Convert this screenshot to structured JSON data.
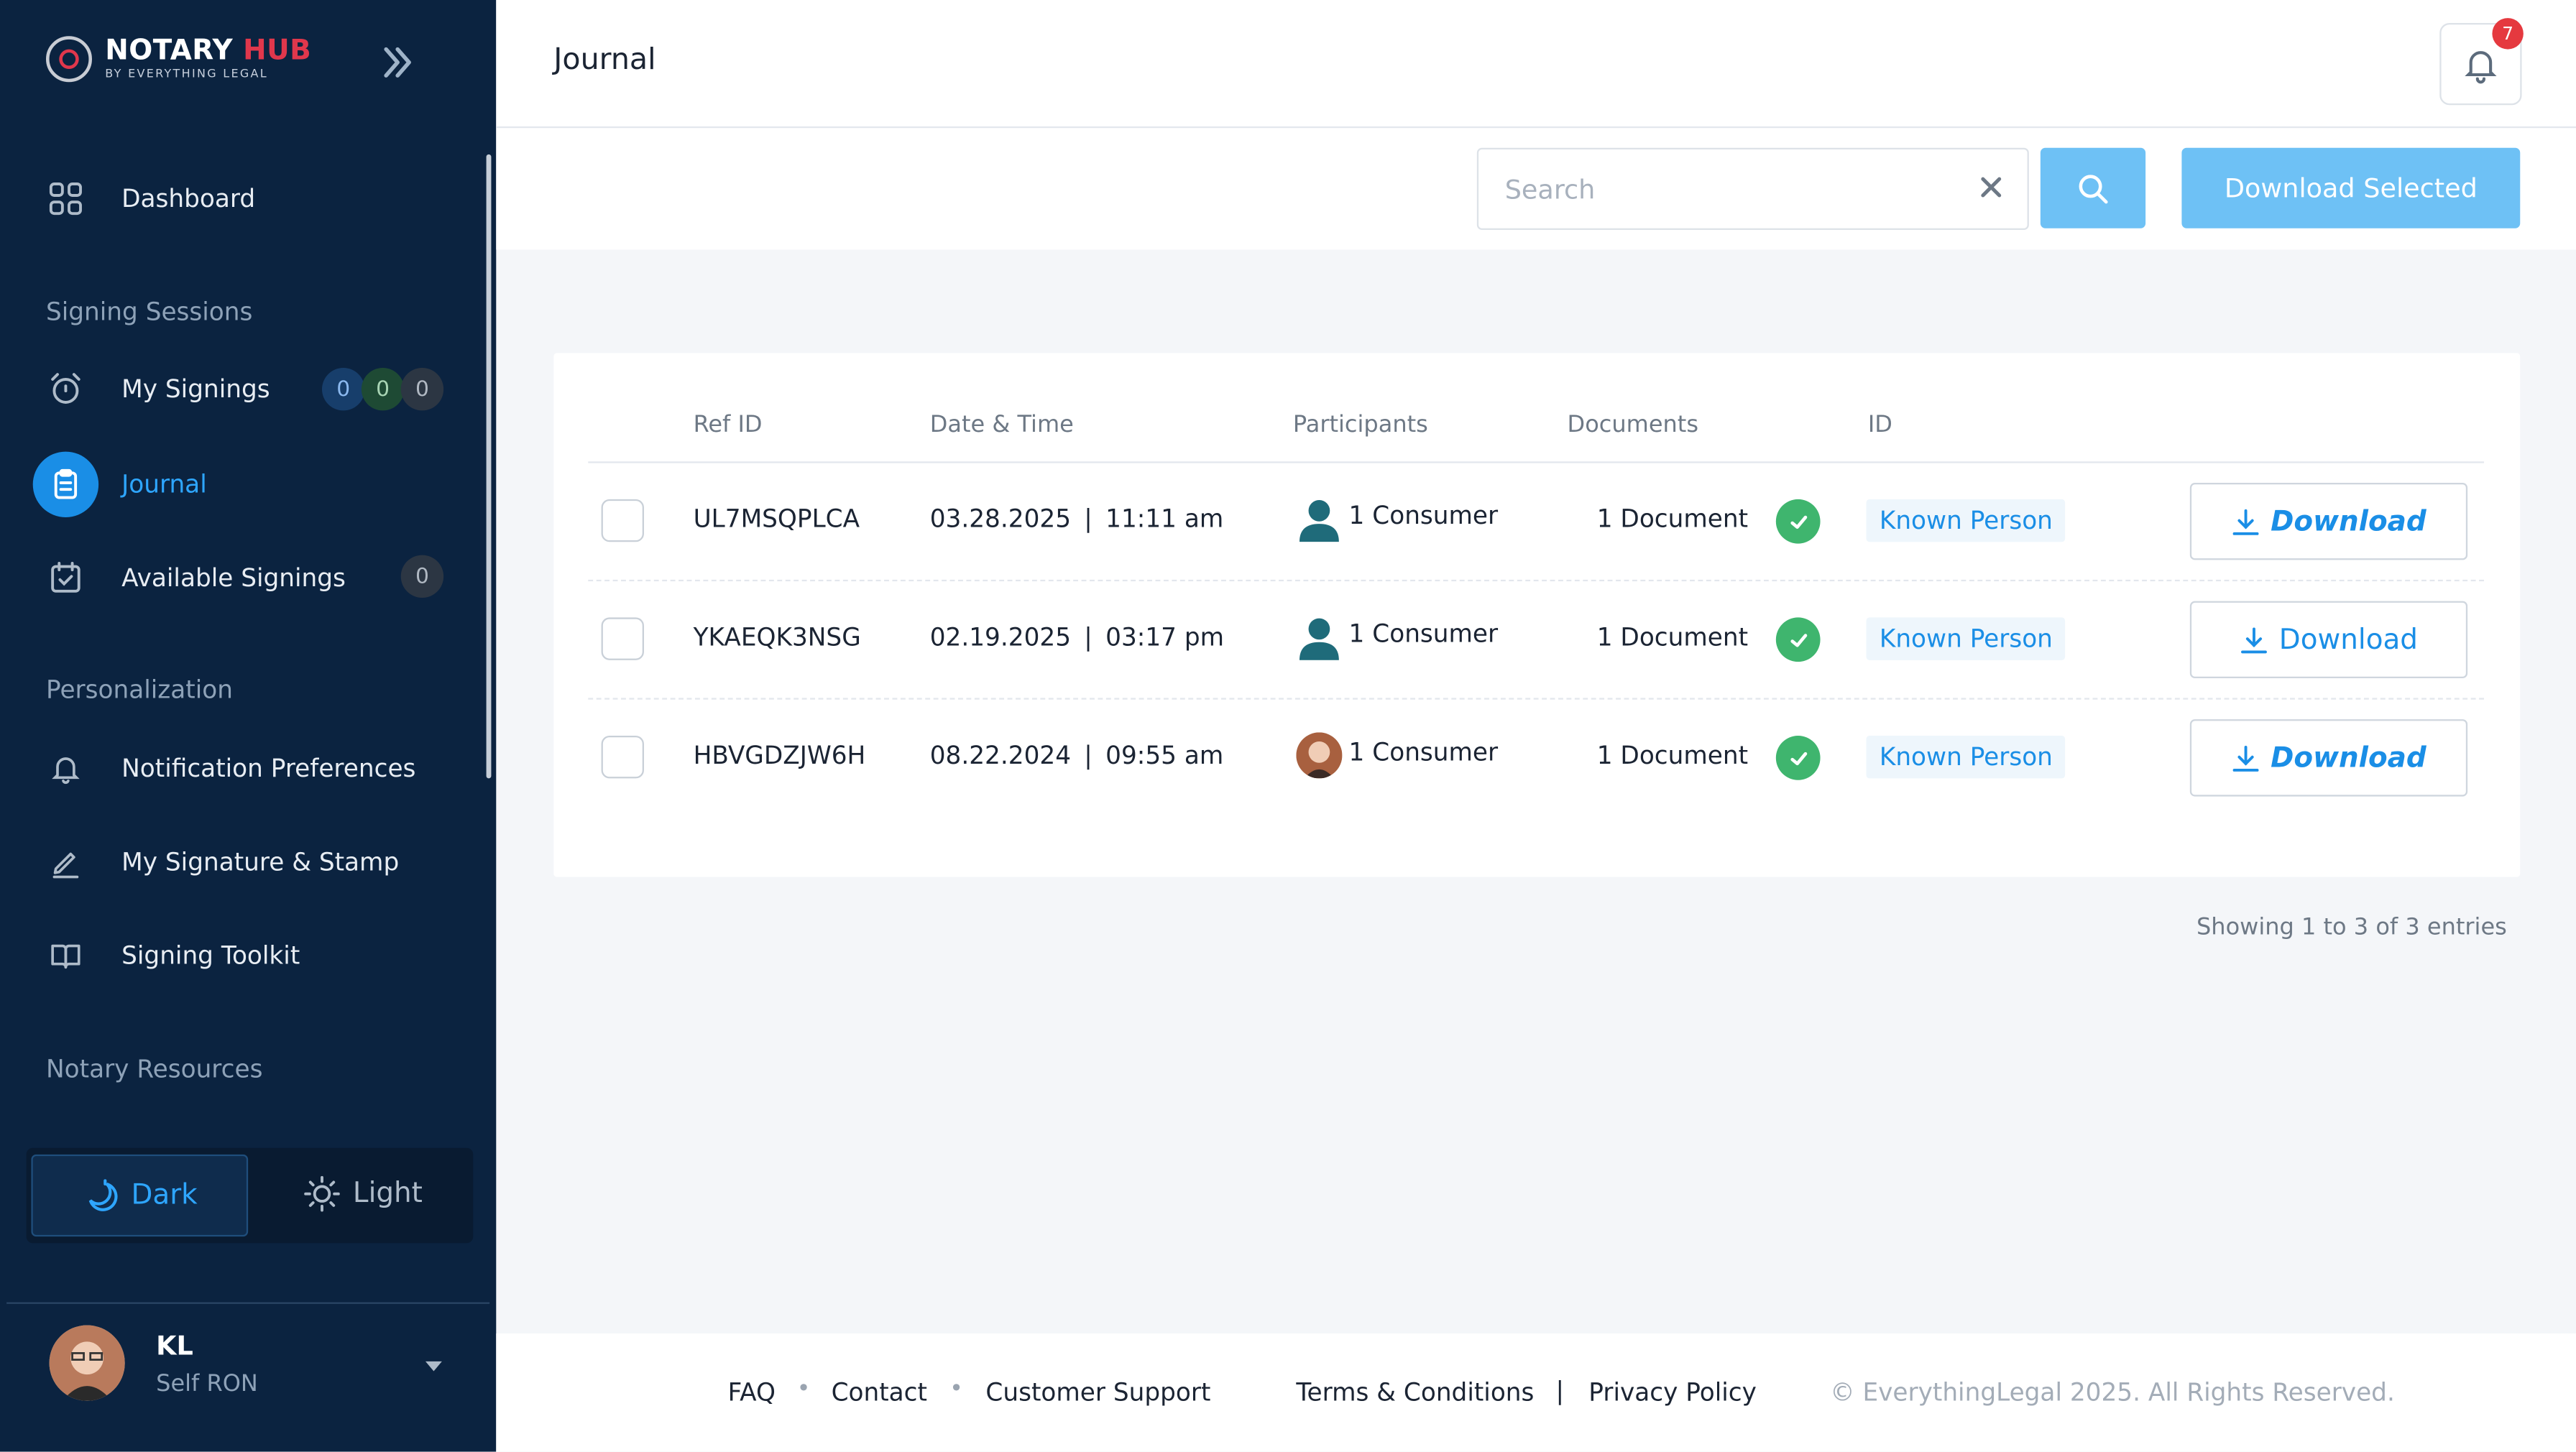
{
  "brand": {
    "name_a": "NOTARY",
    "name_b": "HUB",
    "tagline": "BY EVERYTHING LEGAL"
  },
  "sidebar": {
    "dashboard": "Dashboard",
    "signing_sessions": "Signing Sessions",
    "my_signings": "My Signings",
    "my_signings_counts": [
      "0",
      "0",
      "0"
    ],
    "journal": "Journal",
    "available_signings": "Available Signings",
    "available_count": "0",
    "personalization": "Personalization",
    "notification_prefs": "Notification Preferences",
    "signature_stamp": "My Signature & Stamp",
    "signing_toolkit": "Signing Toolkit",
    "notary_resources": "Notary Resources",
    "theme": {
      "dark": "Dark",
      "light": "Light",
      "selected": "Dark"
    },
    "user": {
      "initials": "KL",
      "role": "Self RON"
    }
  },
  "header": {
    "title": "Journal",
    "notification_count": "7"
  },
  "toolbar": {
    "search_placeholder": "Search",
    "search_value": "",
    "download_selected": "Download Selected"
  },
  "table": {
    "columns": [
      "Ref ID",
      "Date & Time",
      "Participants",
      "Documents",
      "ID"
    ],
    "rows": [
      {
        "ref": "UL7MSQPLCA",
        "date": "03.28.2025",
        "time": "11:11 am",
        "participants": "1 Consumer",
        "documents": "1 Document",
        "id": "Known Person",
        "action": "Download"
      },
      {
        "ref": "YKAEQK3NSG",
        "date": "02.19.2025",
        "time": "03:17 pm",
        "participants": "1 Consumer",
        "documents": "1 Document",
        "id": "Known Person",
        "action": "Download"
      },
      {
        "ref": "HBVGDZJW6H",
        "date": "08.22.2024",
        "time": "09:55 am",
        "participants": "1 Consumer",
        "documents": "1 Document",
        "id": "Known Person",
        "action": "Download"
      }
    ],
    "entries": "Showing 1 to 3 of 3 entries"
  },
  "footer": {
    "faq": "FAQ",
    "contact": "Contact",
    "support": "Customer Support",
    "terms": "Terms & Conditions",
    "privacy": "Privacy Policy",
    "copyright": "© EverythingLegal 2025. All Rights Reserved."
  },
  "colors": {
    "sidebar_bg": "#0b2340",
    "accent": "#1a8ee6",
    "button_light": "#6ec1f5",
    "success": "#3fb56e",
    "notification": "#e5393f"
  }
}
